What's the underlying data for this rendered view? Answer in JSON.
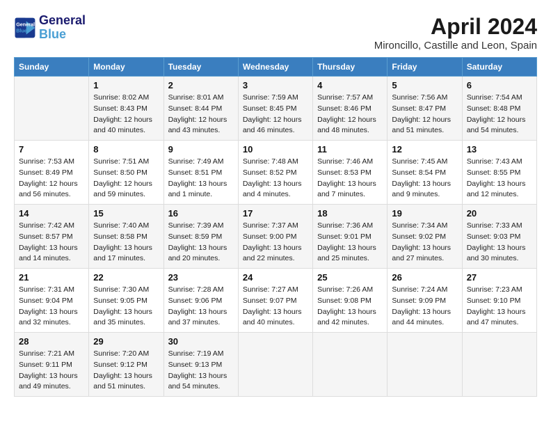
{
  "logo": {
    "line1": "General",
    "line2": "Blue"
  },
  "title": "April 2024",
  "subtitle": "Mironcillo, Castille and Leon, Spain",
  "weekdays": [
    "Sunday",
    "Monday",
    "Tuesday",
    "Wednesday",
    "Thursday",
    "Friday",
    "Saturday"
  ],
  "weeks": [
    [
      {
        "day": "",
        "info": ""
      },
      {
        "day": "1",
        "info": "Sunrise: 8:02 AM\nSunset: 8:43 PM\nDaylight: 12 hours\nand 40 minutes."
      },
      {
        "day": "2",
        "info": "Sunrise: 8:01 AM\nSunset: 8:44 PM\nDaylight: 12 hours\nand 43 minutes."
      },
      {
        "day": "3",
        "info": "Sunrise: 7:59 AM\nSunset: 8:45 PM\nDaylight: 12 hours\nand 46 minutes."
      },
      {
        "day": "4",
        "info": "Sunrise: 7:57 AM\nSunset: 8:46 PM\nDaylight: 12 hours\nand 48 minutes."
      },
      {
        "day": "5",
        "info": "Sunrise: 7:56 AM\nSunset: 8:47 PM\nDaylight: 12 hours\nand 51 minutes."
      },
      {
        "day": "6",
        "info": "Sunrise: 7:54 AM\nSunset: 8:48 PM\nDaylight: 12 hours\nand 54 minutes."
      }
    ],
    [
      {
        "day": "7",
        "info": "Sunrise: 7:53 AM\nSunset: 8:49 PM\nDaylight: 12 hours\nand 56 minutes."
      },
      {
        "day": "8",
        "info": "Sunrise: 7:51 AM\nSunset: 8:50 PM\nDaylight: 12 hours\nand 59 minutes."
      },
      {
        "day": "9",
        "info": "Sunrise: 7:49 AM\nSunset: 8:51 PM\nDaylight: 13 hours\nand 1 minute."
      },
      {
        "day": "10",
        "info": "Sunrise: 7:48 AM\nSunset: 8:52 PM\nDaylight: 13 hours\nand 4 minutes."
      },
      {
        "day": "11",
        "info": "Sunrise: 7:46 AM\nSunset: 8:53 PM\nDaylight: 13 hours\nand 7 minutes."
      },
      {
        "day": "12",
        "info": "Sunrise: 7:45 AM\nSunset: 8:54 PM\nDaylight: 13 hours\nand 9 minutes."
      },
      {
        "day": "13",
        "info": "Sunrise: 7:43 AM\nSunset: 8:55 PM\nDaylight: 13 hours\nand 12 minutes."
      }
    ],
    [
      {
        "day": "14",
        "info": "Sunrise: 7:42 AM\nSunset: 8:57 PM\nDaylight: 13 hours\nand 14 minutes."
      },
      {
        "day": "15",
        "info": "Sunrise: 7:40 AM\nSunset: 8:58 PM\nDaylight: 13 hours\nand 17 minutes."
      },
      {
        "day": "16",
        "info": "Sunrise: 7:39 AM\nSunset: 8:59 PM\nDaylight: 13 hours\nand 20 minutes."
      },
      {
        "day": "17",
        "info": "Sunrise: 7:37 AM\nSunset: 9:00 PM\nDaylight: 13 hours\nand 22 minutes."
      },
      {
        "day": "18",
        "info": "Sunrise: 7:36 AM\nSunset: 9:01 PM\nDaylight: 13 hours\nand 25 minutes."
      },
      {
        "day": "19",
        "info": "Sunrise: 7:34 AM\nSunset: 9:02 PM\nDaylight: 13 hours\nand 27 minutes."
      },
      {
        "day": "20",
        "info": "Sunrise: 7:33 AM\nSunset: 9:03 PM\nDaylight: 13 hours\nand 30 minutes."
      }
    ],
    [
      {
        "day": "21",
        "info": "Sunrise: 7:31 AM\nSunset: 9:04 PM\nDaylight: 13 hours\nand 32 minutes."
      },
      {
        "day": "22",
        "info": "Sunrise: 7:30 AM\nSunset: 9:05 PM\nDaylight: 13 hours\nand 35 minutes."
      },
      {
        "day": "23",
        "info": "Sunrise: 7:28 AM\nSunset: 9:06 PM\nDaylight: 13 hours\nand 37 minutes."
      },
      {
        "day": "24",
        "info": "Sunrise: 7:27 AM\nSunset: 9:07 PM\nDaylight: 13 hours\nand 40 minutes."
      },
      {
        "day": "25",
        "info": "Sunrise: 7:26 AM\nSunset: 9:08 PM\nDaylight: 13 hours\nand 42 minutes."
      },
      {
        "day": "26",
        "info": "Sunrise: 7:24 AM\nSunset: 9:09 PM\nDaylight: 13 hours\nand 44 minutes."
      },
      {
        "day": "27",
        "info": "Sunrise: 7:23 AM\nSunset: 9:10 PM\nDaylight: 13 hours\nand 47 minutes."
      }
    ],
    [
      {
        "day": "28",
        "info": "Sunrise: 7:21 AM\nSunset: 9:11 PM\nDaylight: 13 hours\nand 49 minutes."
      },
      {
        "day": "29",
        "info": "Sunrise: 7:20 AM\nSunset: 9:12 PM\nDaylight: 13 hours\nand 51 minutes."
      },
      {
        "day": "30",
        "info": "Sunrise: 7:19 AM\nSunset: 9:13 PM\nDaylight: 13 hours\nand 54 minutes."
      },
      {
        "day": "",
        "info": ""
      },
      {
        "day": "",
        "info": ""
      },
      {
        "day": "",
        "info": ""
      },
      {
        "day": "",
        "info": ""
      }
    ]
  ]
}
